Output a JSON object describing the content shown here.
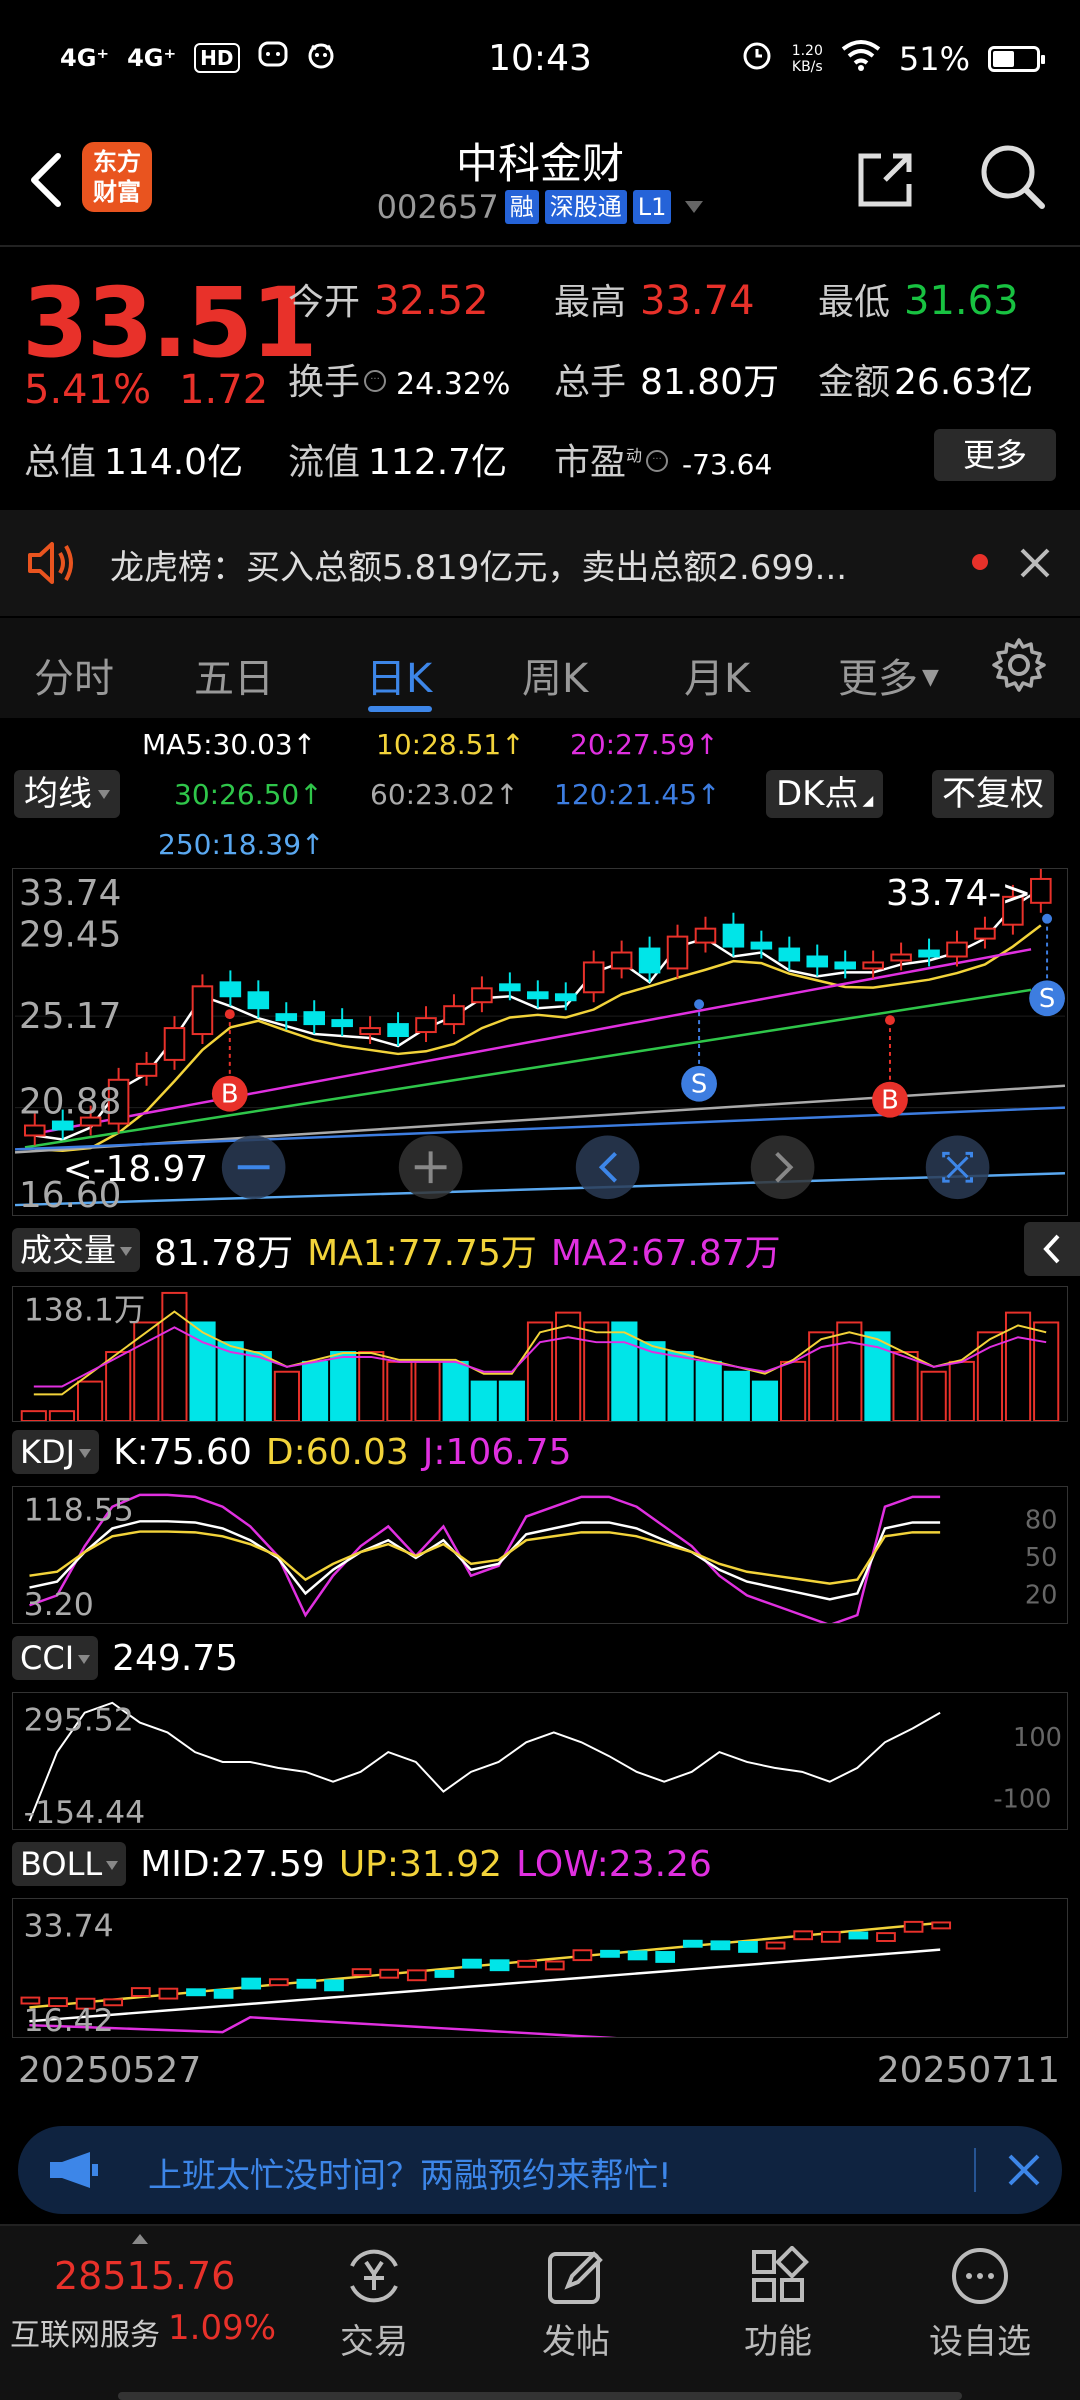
{
  "status_bar": {
    "signal1": "4G⁺",
    "signal2": "4G⁺",
    "hd": "HD",
    "time": "10:43",
    "net_speed_value": "1.20",
    "net_speed_unit": "KB/s",
    "battery": "51%",
    "battery_level": 0.51
  },
  "header": {
    "logo_text": "东方财富",
    "title": "中科金财",
    "code": "002657",
    "tags": [
      "融",
      "深股通",
      "L1"
    ]
  },
  "quote": {
    "price": "33.51",
    "change_pct": "5.41%",
    "change_amt": "1.72",
    "open_label": "今开",
    "open": "32.52",
    "high_label": "最高",
    "high": "33.74",
    "low_label": "最低",
    "low": "31.63",
    "turnover_label": "换手",
    "turnover": "24.32%",
    "volume_label": "总手",
    "volume": "81.80万",
    "amount_label": "金额",
    "amount": "26.63亿",
    "mcap_label": "总值",
    "mcap": "114.0亿",
    "float_label": "流值",
    "float": "112.7亿",
    "pe_label": "市盈",
    "pe_sup": "动",
    "pe": "-73.64",
    "more": "更多"
  },
  "notice": {
    "text": "龙虎榜：买入总额5.819亿元，卖出总额2.699..."
  },
  "tabs": [
    "分时",
    "五日",
    "日K",
    "周K",
    "月K",
    "更多"
  ],
  "active_tab": 2,
  "ma_legend": {
    "ma5": "MA5:30.03↑",
    "ma10": "10:28.51↑",
    "ma20": "20:27.59↑",
    "ma30": "30:26.50↑",
    "ma60": "60:23.02↑",
    "ma120": "120:21.45↑",
    "ma250": "250:18.39↑",
    "btn_ma": "均线",
    "btn_dk": "DK点",
    "btn_fq": "不复权"
  },
  "colors": {
    "up": "#e8312a",
    "down": "#00e5e8",
    "ma5": "#ffffff",
    "ma10": "#f2d33a",
    "ma20": "#e030e0",
    "ma30": "#2fc64a",
    "ma60": "#aaaaaa",
    "ma120": "#3d7de0",
    "ma250": "#5aa8f0",
    "accent": "#3d86e8"
  },
  "main_chart": {
    "y_labels": [
      "33.74",
      "29.45",
      "25.17",
      "20.88",
      "16.60"
    ],
    "high_marker": "33.74->",
    "low_marker": "<-18.97",
    "signals": [
      "B",
      "S",
      "B",
      "S"
    ]
  },
  "volume": {
    "label": "成交量",
    "value": "81.78万",
    "ma1": "MA1:77.75万",
    "ma2": "MA2:67.87万",
    "y_top": "138.1万"
  },
  "kdj": {
    "label": "KDJ",
    "k": "K:75.60",
    "d": "D:60.03",
    "j": "J:106.75",
    "y_top": "118.55",
    "y_bottom": "3.20",
    "ref": [
      "80",
      "50",
      "20"
    ]
  },
  "cci": {
    "label": "CCI",
    "value": "249.75",
    "y_top": "295.52",
    "y_bottom": "-154.44",
    "ref": [
      "100",
      "-100"
    ]
  },
  "boll": {
    "label": "BOLL",
    "mid": "MID:27.59",
    "up": "UP:31.92",
    "low": "LOW:23.26",
    "y_top": "33.74",
    "y_bottom": "16.42"
  },
  "dates": {
    "start": "20250527",
    "end": "20250711"
  },
  "promo": {
    "text": "上班太忙没时间？两融预约来帮忙!"
  },
  "bottom_nav": {
    "index_value": "28515.76",
    "index_name": "互联网服务",
    "index_pct": "1.09%",
    "items": [
      "交易",
      "发帖",
      "功能",
      "设自选"
    ]
  },
  "chart_data": [
    {
      "type": "bar",
      "title": "",
      "x": [
        "20250527",
        "…",
        "20250711"
      ],
      "ylabel": "",
      "ylim": [
        16.6,
        33.74
      ],
      "series": [
        {
          "name": "MA5",
          "values": [
            30.03
          ]
        },
        {
          "name": "10",
          "values": [
            28.51
          ]
        },
        {
          "name": "20",
          "values": [
            27.59
          ]
        },
        {
          "name": "30",
          "values": [
            26.5
          ]
        },
        {
          "name": "60",
          "values": [
            23.02
          ]
        },
        {
          "name": "120",
          "values": [
            21.45
          ]
        },
        {
          "name": "250",
          "values": [
            18.39
          ]
        }
      ]
    }
  ]
}
